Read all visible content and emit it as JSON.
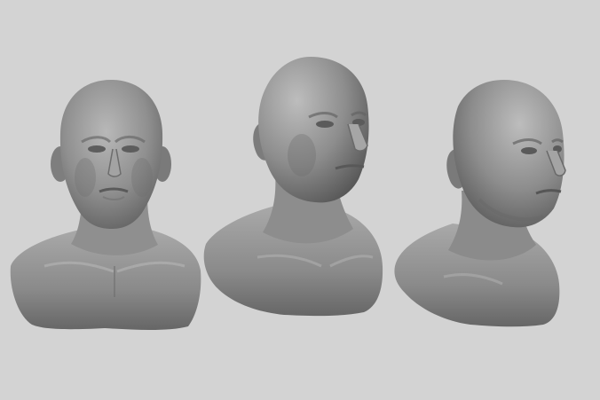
{
  "scene": {
    "background_color": "#d3d3d3",
    "clay_color": "#8e8e8e",
    "subject_count": 3,
    "views": [
      {
        "name": "front-view"
      },
      {
        "name": "three-quarter-view"
      },
      {
        "name": "side-angle-view"
      }
    ]
  }
}
